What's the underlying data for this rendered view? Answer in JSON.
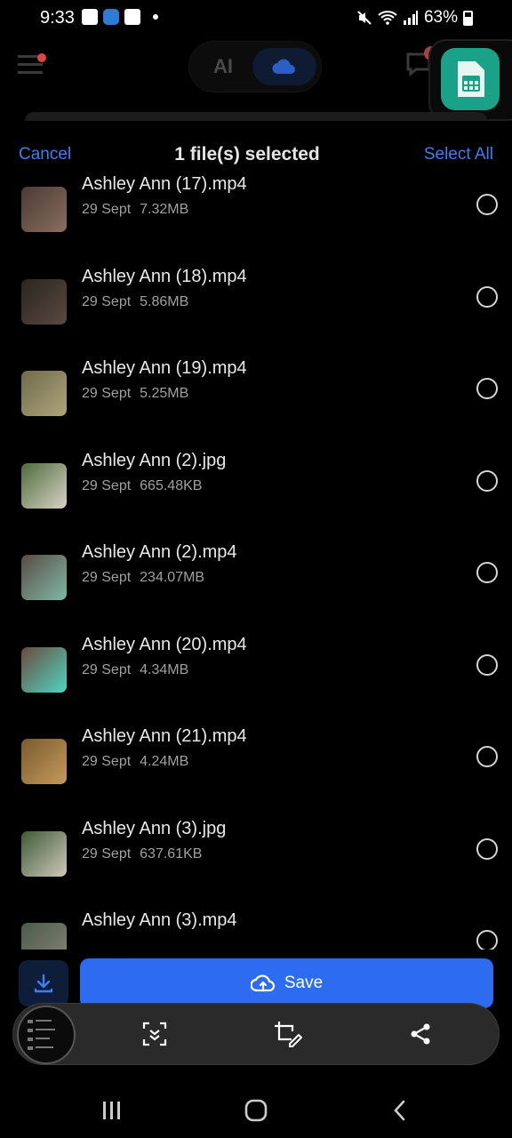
{
  "status_bar": {
    "time": "9:33",
    "battery": "63%"
  },
  "top_bar": {
    "ai_label": "AI",
    "message_badge": "1"
  },
  "selection_header": {
    "cancel": "Cancel",
    "title": "1 file(s) selected",
    "select_all": "Select All"
  },
  "files": [
    {
      "name": "Ashley Ann (17).mp4",
      "date": "29 Sept",
      "size": "7.32MB",
      "thumb": [
        "#4a3a33",
        "#8a6e60"
      ]
    },
    {
      "name": "Ashley Ann (18).mp4",
      "date": "29 Sept",
      "size": "5.86MB",
      "thumb": [
        "#2a2420",
        "#5a4a40"
      ]
    },
    {
      "name": "Ashley Ann (19).mp4",
      "date": "29 Sept",
      "size": "5.25MB",
      "thumb": [
        "#6e6a4a",
        "#b0a57c"
      ]
    },
    {
      "name": "Ashley Ann (2).jpg",
      "date": "29 Sept",
      "size": "665.48KB",
      "thumb": [
        "#4e6b3a",
        "#d8d2c6"
      ]
    },
    {
      "name": "Ashley Ann (2).mp4",
      "date": "29 Sept",
      "size": "234.07MB",
      "thumb": [
        "#5a4b44",
        "#7fb8a6"
      ]
    },
    {
      "name": "Ashley Ann (20).mp4",
      "date": "29 Sept",
      "size": "4.34MB",
      "thumb": [
        "#6b4a3c",
        "#4fd6c4"
      ]
    },
    {
      "name": "Ashley Ann (21).mp4",
      "date": "29 Sept",
      "size": "4.24MB",
      "thumb": [
        "#7a5a2e",
        "#c49a5c"
      ]
    },
    {
      "name": "Ashley Ann (3).jpg",
      "date": "29 Sept",
      "size": "637.61KB",
      "thumb": [
        "#3e5a34",
        "#cfc8bc"
      ]
    },
    {
      "name": "Ashley Ann (3).mp4",
      "date": "",
      "size": "",
      "thumb": [
        "#4a5a4a",
        "#8a8678"
      ]
    }
  ],
  "actions": {
    "save_label": "Save",
    "download_icon": "download-icon",
    "cloud_upload_icon": "cloud-upload-icon"
  },
  "toolbar": {
    "icons": [
      "scroll-capture-icon",
      "crop-edit-icon",
      "share-icon"
    ]
  },
  "navigation": {
    "icons": [
      "recents-icon",
      "home-icon",
      "back-icon"
    ]
  },
  "colors": {
    "accent": "#2d6bf0",
    "link": "#3d7ff0",
    "background": "#000000"
  }
}
